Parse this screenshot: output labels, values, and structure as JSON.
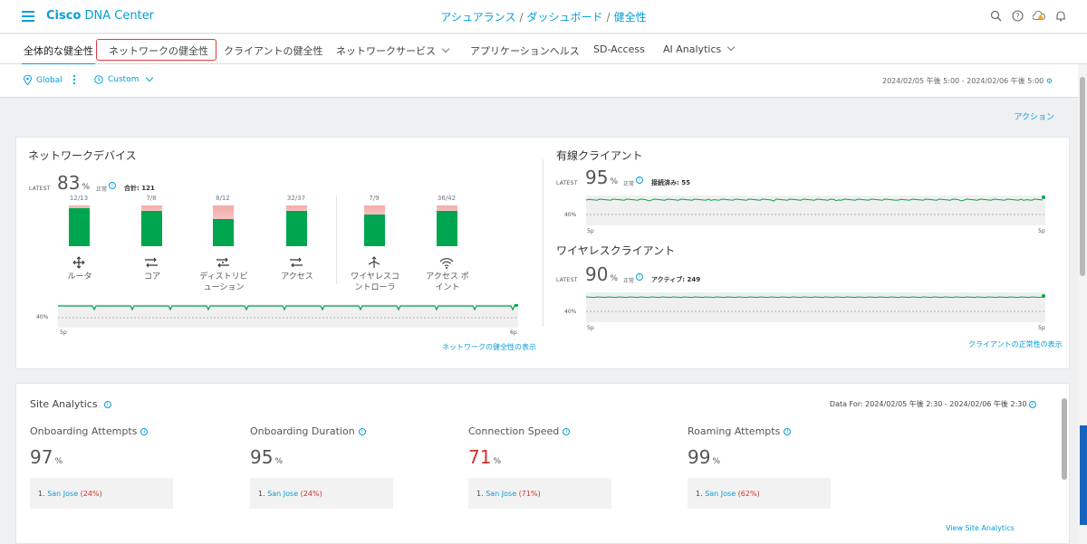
{
  "header": {
    "brand_bold": "Cisco",
    "brand_rest": "DNA Center",
    "breadcrumb": [
      "アシュアランス",
      "ダッシュボード",
      "健全性"
    ],
    "separator": "/"
  },
  "tabs": [
    {
      "label": "全体的な健全性"
    },
    {
      "label": "ネットワークの健全性"
    },
    {
      "label": "クライアントの健全性"
    },
    {
      "label": "ネットワークサービス"
    },
    {
      "label": "アプリケーションヘルス"
    },
    {
      "label": "SD-Access"
    },
    {
      "label": "AI Analytics"
    }
  ],
  "filters": {
    "location": "Global",
    "time": "Custom",
    "date_range": "2024/02/05 午後 5:00 - 2024/02/06 午後 5:00"
  },
  "actions_label": "アクション",
  "network_devices": {
    "title": "ネットワークデバイス",
    "latest": "LATEST",
    "value": "83",
    "pct": "%",
    "status": "正常",
    "total_label": "合計: 121",
    "groups": [
      {
        "count": "12/13",
        "name": "ルータ",
        "icon": "router-icon",
        "healthy_fraction": 0.923
      },
      {
        "count": "7/8",
        "name": "コア",
        "icon": "core-switch-icon",
        "healthy_fraction": 0.875
      },
      {
        "count": "8/12",
        "name": "ディストリビューション",
        "name_l1": "ディストリビ",
        "name_l2": "ューション",
        "icon": "distribution-switch-icon",
        "healthy_fraction": 0.667
      },
      {
        "count": "32/37",
        "name": "アクセス",
        "icon": "access-switch-icon",
        "healthy_fraction": 0.865
      },
      {
        "count": "7/9",
        "name": "ワイヤレスコントローラ",
        "name_l1": "ワイヤレスコ",
        "name_l2": "ントローラ",
        "icon": "wireless-controller-icon",
        "healthy_fraction": 0.778
      },
      {
        "count": "36/42",
        "name": "アクセス ポイント",
        "name_l1": "アクセス ポ",
        "name_l2": "イント",
        "icon": "access-point-icon",
        "healthy_fraction": 0.857
      }
    ],
    "threshold": "40%",
    "x_start": "5p",
    "x_end": "6p",
    "link": "ネットワークの健全性の表示"
  },
  "wired": {
    "title": "有線クライアント",
    "latest": "LATEST",
    "value": "95",
    "pct": "%",
    "status": "正常",
    "count_label": "接続済み: 55",
    "threshold": "40%",
    "x_start": "5p",
    "x_end": "5p"
  },
  "wireless": {
    "title": "ワイヤレスクライアント",
    "latest": "LATEST",
    "value": "90",
    "pct": "%",
    "status": "正常",
    "count_label": "アクティブ: 249",
    "threshold": "40%",
    "x_start": "5p",
    "x_end": "5p",
    "link": "クライアントの正常性の表示"
  },
  "site_analytics": {
    "title": "Site Analytics",
    "date": "Data For: 2024/02/05 午後 2:30 - 2024/02/06 午後 2:30",
    "metrics": [
      {
        "title": "Onboarding Attempts",
        "value": "97",
        "unit": "%",
        "rank": "1.",
        "site": "San Jose",
        "site_pct": "(24%)"
      },
      {
        "title": "Onboarding Duration",
        "value": "95",
        "unit": "%",
        "rank": "1.",
        "site": "San Jose",
        "site_pct": "(24%)"
      },
      {
        "title": "Connection Speed",
        "value": "71",
        "unit": "%",
        "rank": "1.",
        "site": "San Jose",
        "site_pct": "(71%)"
      },
      {
        "title": "Roaming Attempts",
        "value": "99",
        "unit": "%",
        "rank": "1.",
        "site": "San Jose",
        "site_pct": "(62%)"
      }
    ],
    "link": "View Site Analytics"
  },
  "colors": {
    "accent": "#049fd9",
    "healthy": "#00a54f",
    "unhealthy": "#f5a9a9",
    "alert": "#d0312d",
    "warning": "#f5a623"
  }
}
